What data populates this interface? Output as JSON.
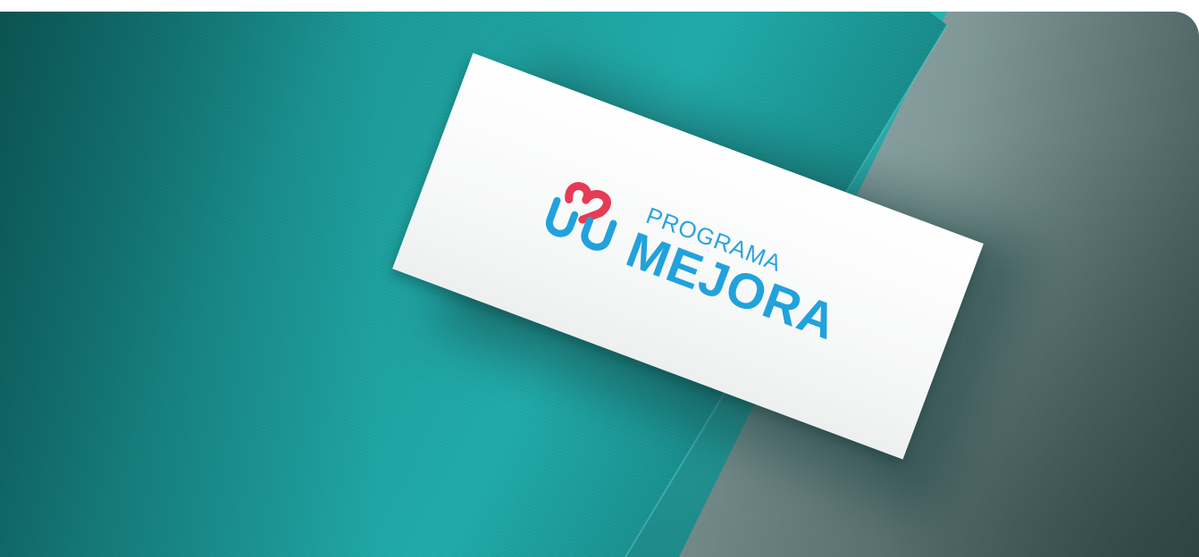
{
  "logo": {
    "line1": "PROGRAMA",
    "line2": "MEJORA"
  },
  "colors": {
    "teal": "#1a9d9c",
    "logo_blue": "#21a2dc",
    "logo_red": "#e63a55",
    "card": "#ffffff"
  }
}
